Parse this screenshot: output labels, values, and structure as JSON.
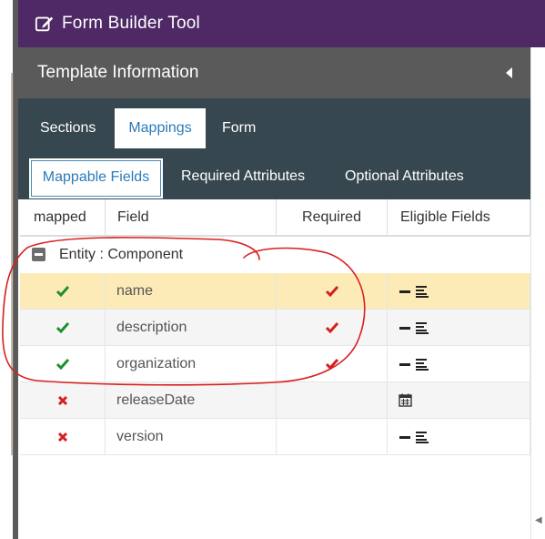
{
  "app": {
    "title": "Form Builder Tool",
    "icon": "edit-icon",
    "header_color": "#4e2966"
  },
  "template_panel": {
    "title": "Template Information",
    "collapse_icon": "caret-left-icon"
  },
  "main_tabs": [
    {
      "label": "Sections",
      "active": false
    },
    {
      "label": "Mappings",
      "active": true
    },
    {
      "label": "Form",
      "active": false
    }
  ],
  "sub_tabs": [
    {
      "label": "Mappable Fields",
      "active": true
    },
    {
      "label": "Required Attributes",
      "active": false
    },
    {
      "label": "Optional Attributes",
      "active": false
    }
  ],
  "grid": {
    "columns": [
      "mapped",
      "Field",
      "Required",
      "Eligible Fields"
    ],
    "group": {
      "label": "Entity : Component",
      "expanded": true
    },
    "rows": [
      {
        "mapped": true,
        "field": "name",
        "required": true,
        "eligible": [
          "minus-icon",
          "align-left-icon"
        ],
        "selected": true
      },
      {
        "mapped": true,
        "field": "description",
        "required": true,
        "eligible": [
          "minus-icon",
          "align-left-icon"
        ],
        "selected": false
      },
      {
        "mapped": true,
        "field": "organization",
        "required": true,
        "eligible": [
          "minus-icon",
          "align-left-icon"
        ],
        "selected": false
      },
      {
        "mapped": false,
        "field": "releaseDate",
        "required": false,
        "eligible": [
          "calendar-icon"
        ],
        "selected": false
      },
      {
        "mapped": false,
        "field": "version",
        "required": false,
        "eligible": [
          "minus-icon",
          "align-left-icon"
        ],
        "selected": false
      }
    ]
  },
  "colors": {
    "accent_blue": "#2b7bb9",
    "check_green": "#1f8f2f",
    "check_red": "#d61f1f",
    "selected_row": "#fdebb7",
    "tab_bar": "#37474f",
    "annotation_red": "#d92020"
  }
}
